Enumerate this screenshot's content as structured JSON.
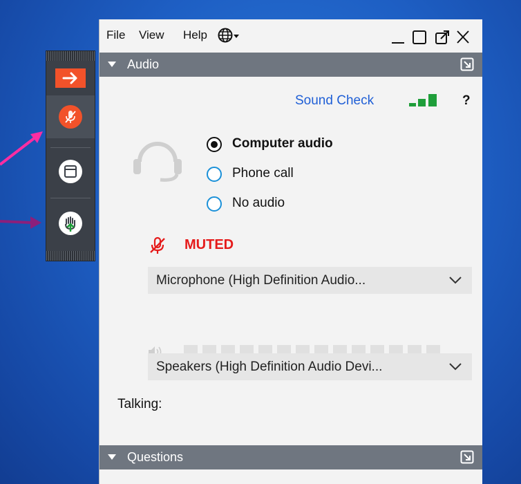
{
  "menubar": {
    "file": "File",
    "view": "View",
    "help": "Help",
    "language_icon": "globe-icon"
  },
  "window_controls": [
    "minimize-icon",
    "restore-icon",
    "popout-icon",
    "close-icon"
  ],
  "audio_panel": {
    "header": "Audio",
    "sound_check": "Sound Check",
    "help_mark": "?",
    "options": [
      {
        "label": "Computer audio",
        "selected": true
      },
      {
        "label": "Phone call",
        "selected": false
      },
      {
        "label": "No audio",
        "selected": false
      }
    ],
    "mute_status": "MUTED",
    "microphone": "Microphone (High Definition Audio...",
    "speakers": "Speakers (High Definition Audio Devi...",
    "talking_label": "Talking:"
  },
  "questions_panel": {
    "header": "Questions"
  },
  "sidebar": {
    "items": [
      "arrow-right-icon",
      "microphone-muted-icon",
      "window-icon",
      "raise-hand-icon"
    ]
  },
  "colors": {
    "accent_orange": "#f2522a",
    "muted_red": "#e51b1b",
    "sound_check_blue": "#1f5fd6",
    "signal_green": "#1f9e3a",
    "header_gray": "#6f7680",
    "annotation_pink": "#ff2da2",
    "annotation_purple": "#8b1f7b"
  }
}
